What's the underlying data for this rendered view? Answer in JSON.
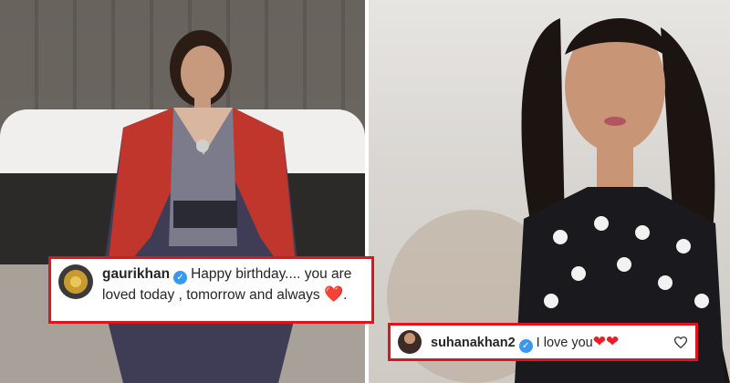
{
  "comments": [
    {
      "username": "gaurikhan",
      "text": "Happy birthday.... you are loved today , tomorrow and always",
      "emoji": "❤️",
      "punctuation": "."
    },
    {
      "username": "suhanakhan2",
      "text": "I love you",
      "emoji": "❤❤"
    }
  ],
  "colors": {
    "highlight_border": "#e0141c",
    "verified_badge": "#3897f0",
    "heart": "#ed1c24"
  },
  "icons": {
    "verified": "verified-badge-icon",
    "like": "heart-outline-icon"
  }
}
